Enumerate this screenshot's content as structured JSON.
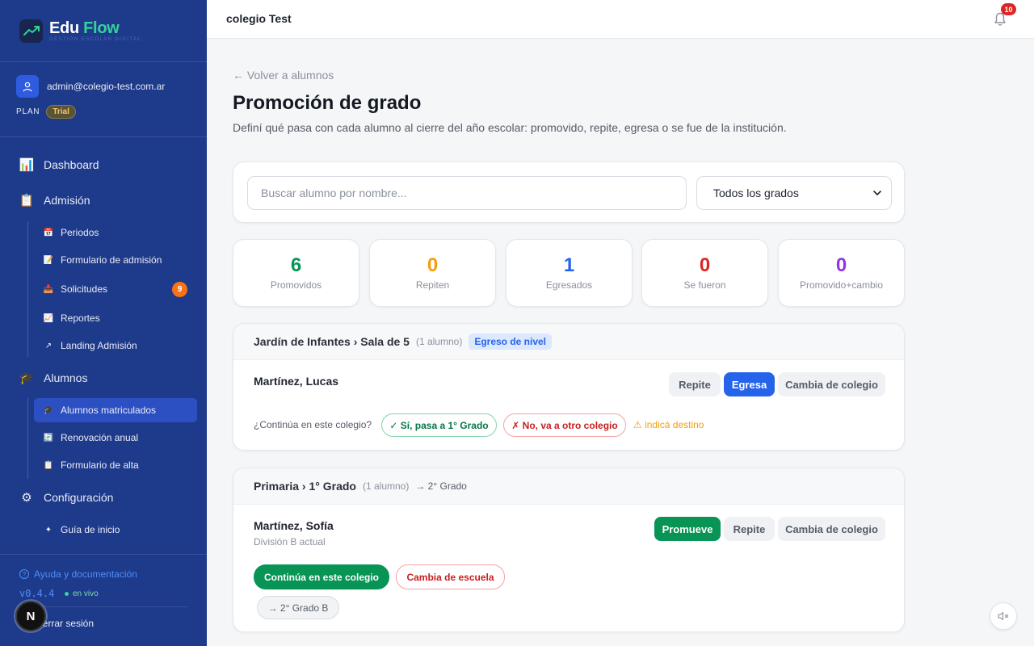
{
  "brand": {
    "edu": "Edu",
    "flow": "Flow",
    "subtitle": "GESTIÓN ESCOLAR DIGITAL"
  },
  "user": {
    "email": "admin@colegio-test.com.ar",
    "plan_label": "PLAN",
    "plan": "Trial"
  },
  "nav": {
    "dashboard": "Dashboard",
    "admision": "Admisión",
    "periodos": "Periodos",
    "formulario_admision": "Formulario de admisión",
    "solicitudes": "Solicitudes",
    "solicitudes_count": "9",
    "reportes": "Reportes",
    "landing": "Landing Admisión",
    "alumnos": "Alumnos",
    "matriculados": "Alumnos matriculados",
    "renovacion": "Renovación anual",
    "formulario_alta": "Formulario de alta",
    "configuracion": "Configuración",
    "guia": "Guía de inicio"
  },
  "footer": {
    "help": "Ayuda y documentación",
    "version": "v0.4.4",
    "live": "en vivo",
    "logout": "Cerrar sesión",
    "n_bubble": "N"
  },
  "topbar": {
    "title": "colegio Test",
    "notifications": "10"
  },
  "page": {
    "back": "← Volver a alumnos",
    "title": "Promoción de grado",
    "description": "Definí qué pasa con cada alumno al cierre del año escolar: promovido, repite, egresa o se fue de la institución."
  },
  "filters": {
    "search_placeholder": "Buscar alumno por nombre...",
    "grade_selected": "Todos los grados"
  },
  "stats": [
    {
      "value": "6",
      "label": "Promovidos",
      "color": "#079455"
    },
    {
      "value": "0",
      "label": "Repiten",
      "color": "#f59e0b"
    },
    {
      "value": "1",
      "label": "Egresados",
      "color": "#2563eb"
    },
    {
      "value": "0",
      "label": "Se fueron",
      "color": "#dc2626"
    },
    {
      "value": "0",
      "label": "Promovido+cambio",
      "color": "#9333ea"
    }
  ],
  "groups": [
    {
      "name": "Jardín de Infantes › Sala de 5",
      "count": "(1 alumno)",
      "badge": "Egreso de nivel",
      "student": "Martínez, Lucas",
      "buttons": [
        "Repite",
        "Egresa",
        "Cambia de colegio"
      ],
      "question": "¿Continúa en este colegio?",
      "yes": "✓ Sí, pasa a 1° Grado",
      "no": "✗ No, va a otro colegio",
      "warning": "⚠ indicá destino"
    },
    {
      "name": "Primaria › 1° Grado",
      "count": "(1 alumno)",
      "next": "→ 2° Grado",
      "student": "Martínez, Sofía",
      "division": "División B actual",
      "buttons": [
        "Promueve",
        "Repite",
        "Cambia de colegio"
      ],
      "continue": "Continúa en este colegio",
      "change": "Cambia de escuela",
      "target": "→ 2° Grado B"
    }
  ]
}
